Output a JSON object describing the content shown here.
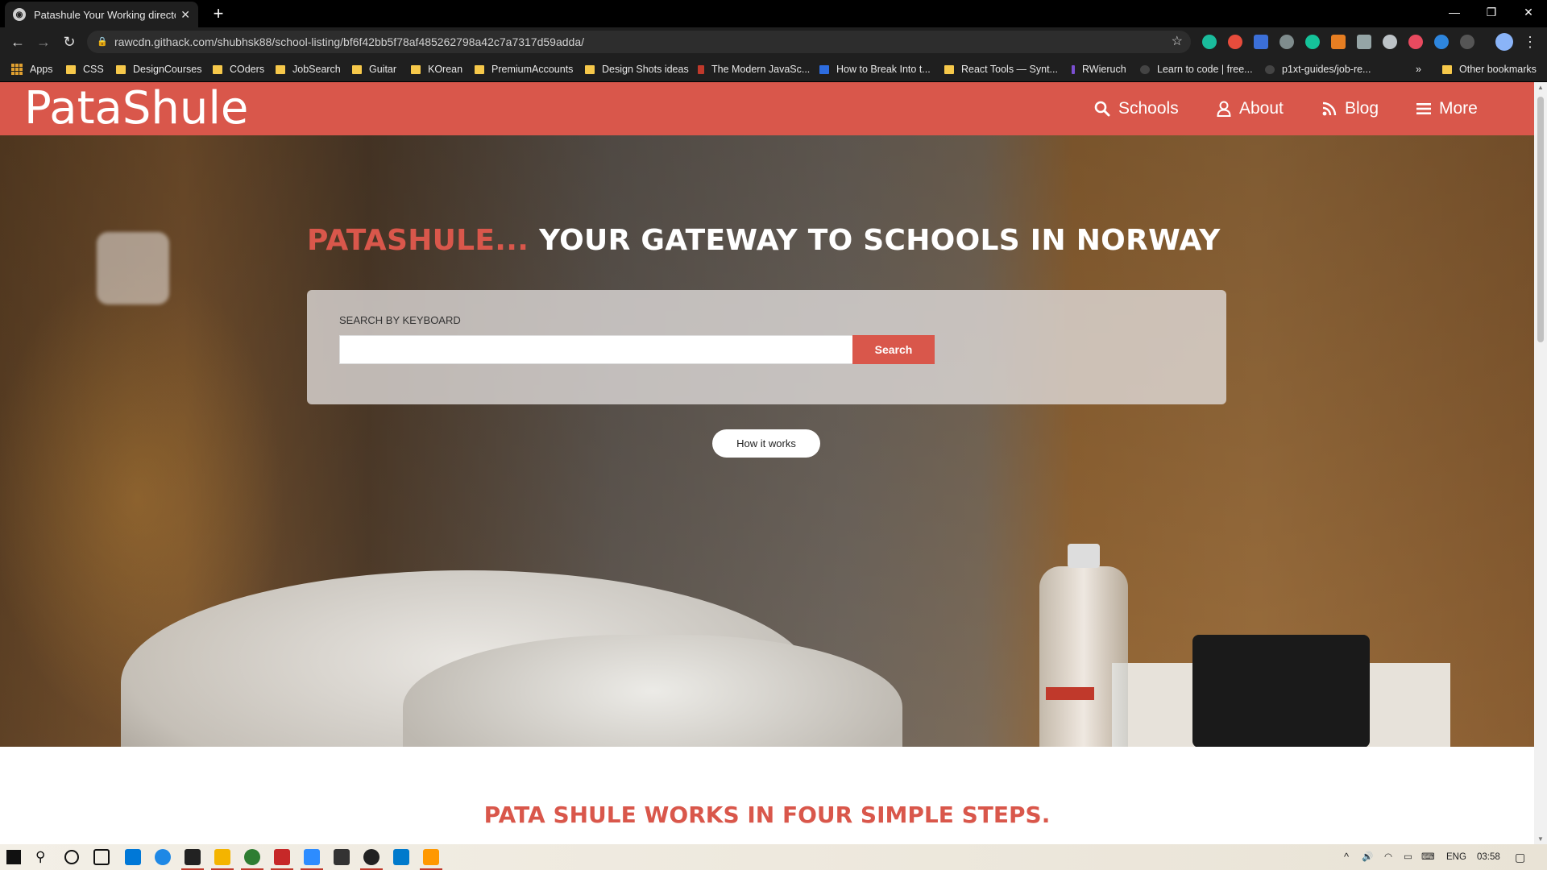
{
  "browser": {
    "tab_title": "Patashule Your Working directory",
    "url": "rawcdn.githack.com/shubhsk88/school-listing/bf6f42bb5f78af485262798a42c7a7317d59adda/",
    "bookmarks": [
      "Apps",
      "CSS",
      "DesignCourses",
      "COders",
      "JobSearch",
      "Guitar",
      "KOrean",
      "PremiumAccounts",
      "Design Shots ideas",
      "The Modern JavaSc...",
      "How to Break Into t...",
      "React Tools — Synt...",
      "RWieruch",
      "Learn to code | free...",
      "p1xt-guides/job-re..."
    ],
    "overflow": "»",
    "other_bookmarks": "Other bookmarks"
  },
  "site": {
    "logo": "PataShule",
    "nav": [
      "Schools",
      "About",
      "Blog",
      "More"
    ],
    "hero": {
      "title_accent": "PATASHULE...",
      "title_rest": "YOUR GATEWAY TO SCHOOLS IN NORWAY",
      "search_label": "SEARCH BY KEYBOARD",
      "search_value": "",
      "search_button": "Search",
      "how_button": "How it works"
    },
    "steps_title": "PATA SHULE WORKS IN FOUR SIMPLE STEPS."
  },
  "taskbar": {
    "language": "ENG",
    "time": "03:58"
  },
  "colors": {
    "brand": "#d9574b"
  }
}
